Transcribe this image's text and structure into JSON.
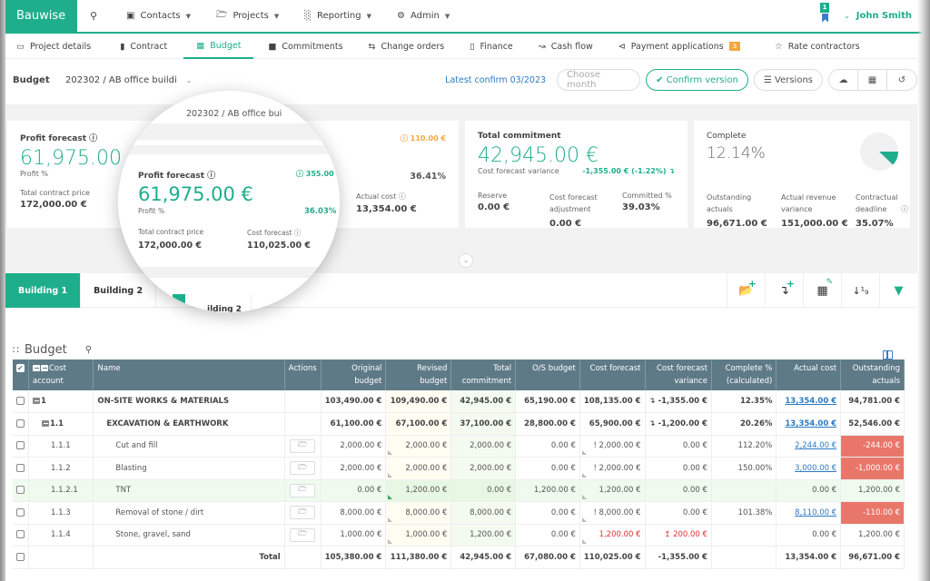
{
  "topnav": {
    "brand": "Bauwise",
    "items": [
      {
        "label": "Contacts",
        "icon": "address-card-icon"
      },
      {
        "label": "Projects",
        "icon": "folder-icon"
      },
      {
        "label": "Reporting",
        "icon": "bar-chart-icon"
      },
      {
        "label": "Admin",
        "icon": "gear-icon"
      }
    ],
    "notification_count": "1",
    "user": "John Smith"
  },
  "subnav": {
    "items": [
      {
        "label": "Project details",
        "icon": "monitor-icon"
      },
      {
        "label": "Contract",
        "icon": "bookmark-icon"
      },
      {
        "label": "Budget",
        "icon": "calculator-icon",
        "active": true
      },
      {
        "label": "Commitments",
        "icon": "archive-icon"
      },
      {
        "label": "Change orders",
        "icon": "exchange-icon"
      },
      {
        "label": "Finance",
        "icon": "book-icon"
      },
      {
        "label": "Cash flow",
        "icon": "line-chart-icon"
      },
      {
        "label": "Payment applications",
        "icon": "share-icon",
        "badge": "3"
      },
      {
        "label": "Rate contractors",
        "icon": "star-icon"
      }
    ]
  },
  "budgetbar": {
    "label": "Budget",
    "selected": "202302 / AB office buildi",
    "latest_confirm": "Latest confirm 03/2023",
    "month_placeholder": "Choose month",
    "confirm_label": "Confirm version",
    "versions_label": "Versions"
  },
  "cards": {
    "profit": {
      "title": "Profit forecast",
      "value": "61,975.00 €",
      "profit_pct_label": "Profit %",
      "contract_label": "Total contract price",
      "contract_value": "172,000.00 €"
    },
    "cost": {
      "warning": "110.00 €",
      "pct": "36.41%",
      "actual_label": "Actual cost",
      "actual_value": "13,354.00 €"
    },
    "commitment": {
      "title": "Total commitment",
      "value": "42,945.00 €",
      "variance_label": "Cost forecast variance",
      "variance_value": "-1,355.00 € (-1.22%) ↴",
      "reserve_label": "Reserve",
      "reserve_value": "0.00 €",
      "adj_label": "Cost forecast adjustment",
      "adj_value": "0.00 €",
      "committed_label": "Committed %",
      "committed_value": "39.03%"
    },
    "complete": {
      "title": "Complete",
      "value": "12.14%",
      "pie_fraction": 0.1214,
      "outstanding_label": "Outstanding actuals",
      "outstanding_value": "96,671.00 €",
      "revenue_label": "Actual revenue variance",
      "revenue_value": "151,000.00 €",
      "deadline_label": "Contractual deadline",
      "deadline_value": "35.07%"
    }
  },
  "magnifier": {
    "budget_text": "202302 / AB office bui",
    "title": "Profit forecast",
    "badge": "355.00",
    "value": "61,975.00 €",
    "profit_pct_label": "Profit %",
    "profit_pct": "36.03%",
    "contract_label": "Total contract price",
    "contract_value": "172,000.00 €",
    "forecast_label": "Cost forecast",
    "forecast_value": "110,025.00 €",
    "tab_text": "ilding 2"
  },
  "building_tabs": [
    "Building 1",
    "Building 2"
  ],
  "table": {
    "title": "Budget",
    "headers": [
      "Cost account",
      "Name",
      "Actions",
      "Original budget",
      "Revised budget",
      "Total commitment",
      "O/S budget",
      "Cost forecast",
      "Cost forecast variance",
      "Complete % (calculated)",
      "Actual cost",
      "Outstanding actuals"
    ],
    "rows": [
      {
        "account": "1",
        "name": "ON-SITE WORKS & MATERIALS",
        "orig": "103,490.00 €",
        "rev": "109,490.00 €",
        "com": "42,945.00 €",
        "os": "65,190.00 €",
        "fc": "108,135.00 €",
        "var": "↴ -1,355.00 €",
        "pct": "12.35%",
        "actual": "13,354.00 €",
        "out": "94,781.00 €"
      },
      {
        "account": "1.1",
        "name": "EXCAVATION & EARTHWORK",
        "orig": "61,100.00 €",
        "rev": "67,100.00 €",
        "com": "37,100.00 €",
        "os": "28,800.00 €",
        "fc": "65,900.00 €",
        "var": "↴ -1,200.00 €",
        "pct": "20.26%",
        "actual": "13,354.00 €",
        "out": "52,546.00 €"
      },
      {
        "account": "1.1.1",
        "name": "Cut and fill",
        "orig": "2,000.00 €",
        "rev": "2,000.00 €",
        "com": "2,000.00 €",
        "os": "0.00 €",
        "fc": "! 2,000.00 €",
        "var": "0.00 €",
        "pct": "112.20%",
        "actual": "2,244.00 €",
        "out": "-244.00 €"
      },
      {
        "account": "1.1.2",
        "name": "Blasting",
        "orig": "2,000.00 €",
        "rev": "2,000.00 €",
        "com": "2,000.00 €",
        "os": "0.00 €",
        "fc": "! 2,000.00 €",
        "var": "0.00 €",
        "pct": "150.00%",
        "actual": "3,000.00 €",
        "out": "-1,000.00 €"
      },
      {
        "account": "1.1.2.1",
        "name": "TNT",
        "orig": "0.00 €",
        "rev": "1,200.00 €",
        "com": "0.00 €",
        "os": "1,200.00 €",
        "fc": "1,200.00 €",
        "var": "0.00 €",
        "pct": "",
        "actual": "0.00 €",
        "out": "1,200.00 €"
      },
      {
        "account": "1.1.3",
        "name": "Removal of stone / dirt",
        "orig": "8,000.00 €",
        "rev": "8,000.00 €",
        "com": "8,000.00 €",
        "os": "0.00 €",
        "fc": "! 8,000.00 €",
        "var": "0.00 €",
        "pct": "101.38%",
        "actual": "8,110.00 €",
        "out": "-110.00 €"
      },
      {
        "account": "1.1.4",
        "name": "Stone, gravel, sand",
        "orig": "1,000.00 €",
        "rev": "1,000.00 €",
        "com": "1,200.00 €",
        "os": "0.00 €",
        "fc": "1,200.00 €",
        "var": "↥ 200.00 €",
        "pct": "",
        "actual": "0.00 €",
        "out": "1,200.00 €"
      }
    ],
    "total": {
      "label": "Total",
      "orig": "105,380.00 €",
      "rev": "111,380.00 €",
      "com": "42,945.00 €",
      "os": "67,080.00 €",
      "fc": "110,025.00 €",
      "var": "-1,355.00 €",
      "pct": "",
      "actual": "13,354.00 €",
      "out": "96,671.00 €"
    }
  },
  "colors": {
    "accent": "#1fae8c",
    "warning": "#f5a742",
    "negative": "#e8776a",
    "header": "#5f7a87",
    "link": "#2c7ac2"
  }
}
